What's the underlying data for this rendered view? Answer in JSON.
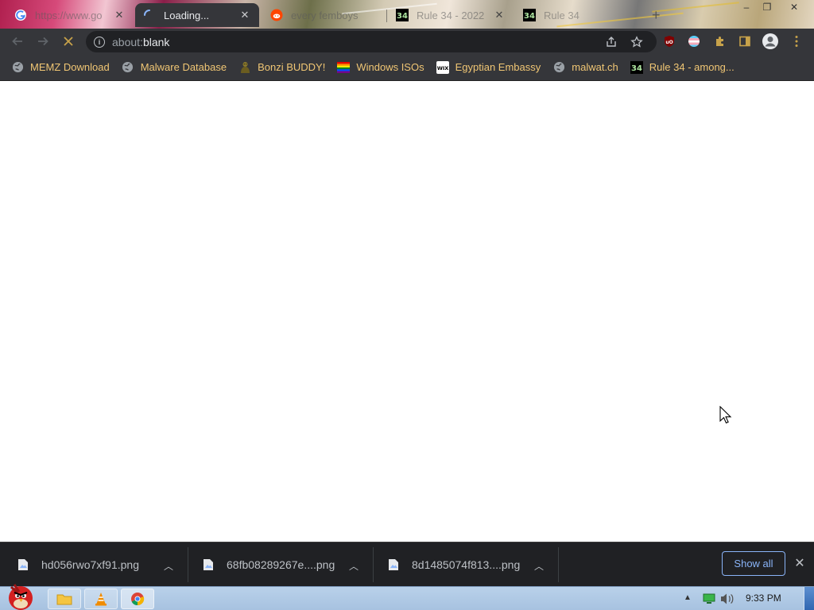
{
  "tabs": [
    {
      "title": "https://www.go",
      "favicon": "google-g-icon",
      "close": "✕"
    },
    {
      "title": "Loading...",
      "favicon": "loading-spinner-icon",
      "close": "✕",
      "active": true
    },
    {
      "title": "every femboys",
      "favicon": "reddit-icon",
      "close": ""
    },
    {
      "title": "Rule 34 - 2022",
      "favicon": "rule34-icon",
      "close": "✕"
    },
    {
      "title": "Rule 34",
      "favicon": "rule34-icon",
      "close": ""
    }
  ],
  "new_tab": "+",
  "window_controls": {
    "minimize": "–",
    "restore": "❐",
    "close": "✕"
  },
  "omnibox": {
    "scheme": "about:",
    "host": "blank"
  },
  "bookmarks": [
    {
      "label": "MEMZ Download",
      "icon": "globe-icon"
    },
    {
      "label": "Malware Database",
      "icon": "globe-icon"
    },
    {
      "label": "Bonzi BUDDY!",
      "icon": "bonzi-icon"
    },
    {
      "label": "Windows ISOs",
      "icon": "rainbow-flag-icon"
    },
    {
      "label": "Egyptian Embassy",
      "icon": "wix-icon"
    },
    {
      "label": "malwat.ch",
      "icon": "globe-icon"
    },
    {
      "label": "Rule 34 - among...",
      "icon": "rule34-icon"
    }
  ],
  "downloads": [
    {
      "filename": "hd056rwo7xf91.png"
    },
    {
      "filename": "68fb08289267e....png"
    },
    {
      "filename": "8d1485074f813....png"
    }
  ],
  "download_shelf": {
    "show_all": "Show all",
    "close": "✕"
  },
  "taskbar": {
    "clock": "9:33 PM"
  },
  "colors": {
    "chrome_dark": "#35363a",
    "omnibox": "#202124",
    "bookmark_text": "#f0c674",
    "accent": "#8ab4f8",
    "taskbar": "#b9d1ea"
  }
}
